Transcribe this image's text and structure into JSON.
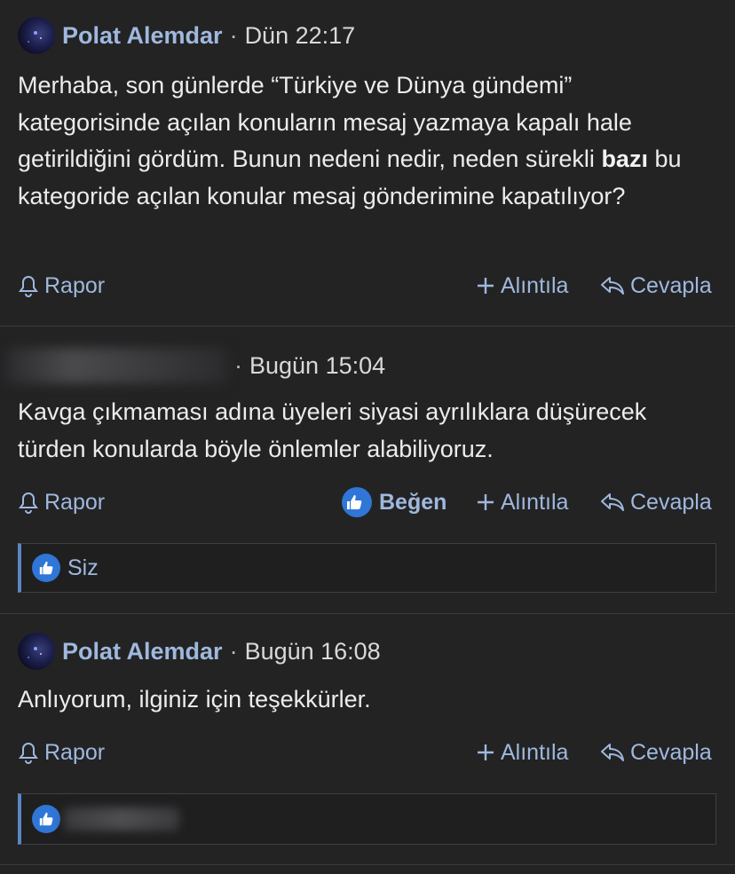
{
  "posts": [
    {
      "author": "Polat Alemdar",
      "separator": "·",
      "time": "Dün 22:17",
      "body_pre": "Merhaba, son günlerde “Türkiye ve Dünya gündemi” kategorisinde açılan konuların mesaj yazmaya kapalı hale getirildiğini gördüm. Bunun nedeni nedir, neden sürekli ",
      "body_bold": "bazı",
      "body_post": " bu kategoride açılan konular mesaj gönderimine kapatılıyor?",
      "actions": {
        "report": "Rapor",
        "quote": "Alıntıla",
        "reply": "Cevapla"
      }
    },
    {
      "separator": "·",
      "time": "Bugün 15:04",
      "body": "Kavga çıkmaması adına üyeleri siyasi ayrılıklara düşürecek türden konularda böyle önlemler alabiliyoruz.",
      "actions": {
        "report": "Rapor",
        "like": "Beğen",
        "quote": "Alıntıla",
        "reply": "Cevapla"
      },
      "reactions": "Siz"
    },
    {
      "author": "Polat Alemdar",
      "separator": "·",
      "time": "Bugün 16:08",
      "body": "Anlıyorum, ilginiz için teşekkürler.",
      "actions": {
        "report": "Rapor",
        "quote": "Alıntıla",
        "reply": "Cevapla"
      }
    }
  ],
  "icons": [
    "avatar",
    "bell-icon",
    "plus-icon",
    "reply-arrow-icon",
    "thumbs-up-icon"
  ],
  "colors": {
    "background": "#232324",
    "link": "#9fb8de",
    "like_blue": "#2f76d6",
    "reaction_border": "#5a87c2"
  }
}
